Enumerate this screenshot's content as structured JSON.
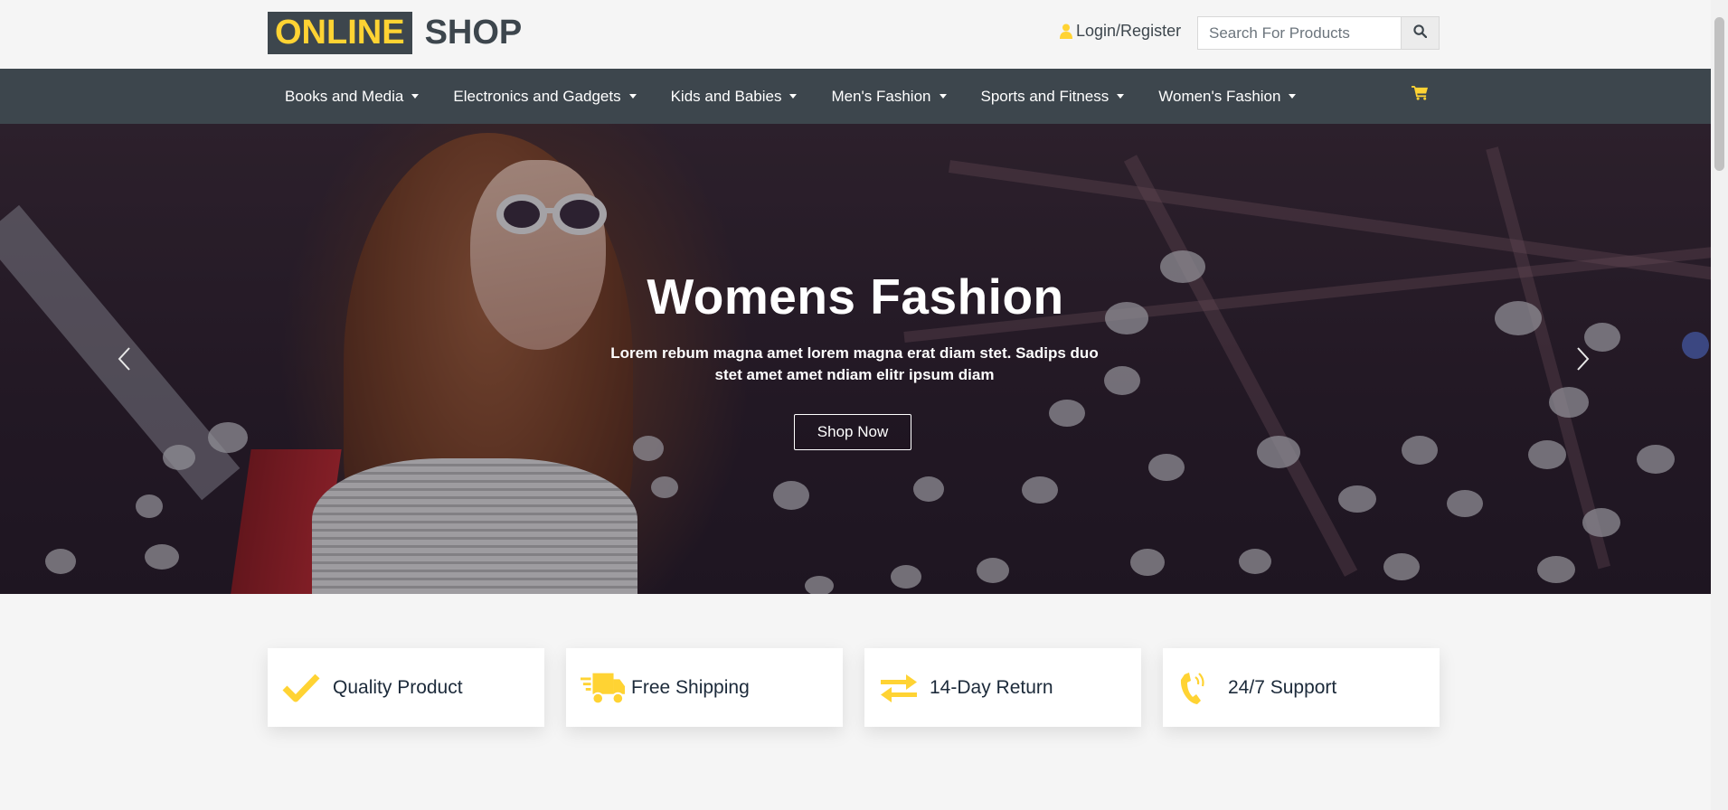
{
  "header": {
    "logo_primary": "ONLINE",
    "logo_secondary": "SHOP",
    "login_label": "Login/Register",
    "search_placeholder": "Search For Products",
    "search_value": ""
  },
  "nav": {
    "items": [
      {
        "label": "Books and Media"
      },
      {
        "label": "Electronics and Gadgets"
      },
      {
        "label": "Kids and Babies"
      },
      {
        "label": "Men's Fashion"
      },
      {
        "label": "Sports and Fitness"
      },
      {
        "label": "Women's Fashion"
      }
    ],
    "cart_icon": "shopping-cart-icon"
  },
  "hero": {
    "title": "Womens Fashion",
    "description": "Lorem rebum magna amet lorem magna erat diam stet. Sadips duo stet amet amet ndiam elitr ipsum diam",
    "button_label": "Shop Now"
  },
  "features": [
    {
      "icon": "check-icon",
      "label": "Quality Product"
    },
    {
      "icon": "shipping-truck-icon",
      "label": "Free Shipping"
    },
    {
      "icon": "exchange-arrows-icon",
      "label": "14-Day Return"
    },
    {
      "icon": "phone-volume-icon",
      "label": "24/7 Support"
    }
  ],
  "colors": {
    "accent": "#FFD333",
    "dark": "#3D464D",
    "background": "#F5F5F5"
  }
}
